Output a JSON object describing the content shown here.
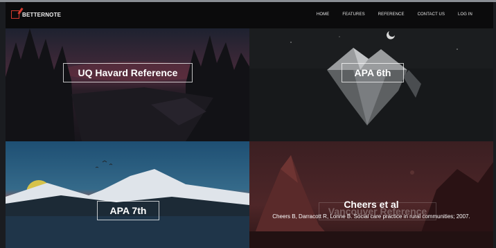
{
  "brand": {
    "name": "BETTERNOTE"
  },
  "nav": {
    "items": [
      "HOME",
      "FEATURES",
      "REFERENCE",
      "CONTACT US",
      "LOG IN"
    ]
  },
  "tiles": {
    "uq_harvard": {
      "label": "UQ Havard Reference"
    },
    "apa6": {
      "label": "APA 6th"
    },
    "apa7": {
      "label": "APA 7th"
    },
    "vancouver": {
      "label": "Vancouver Reference",
      "citation_title": "Cheers et al",
      "citation_text": "Cheers B, Darracott R, Lonne B. Social care practice in rural communities; 2007."
    }
  },
  "colors": {
    "accent": "#d43a2f",
    "navbar": "#0b0b0c"
  }
}
